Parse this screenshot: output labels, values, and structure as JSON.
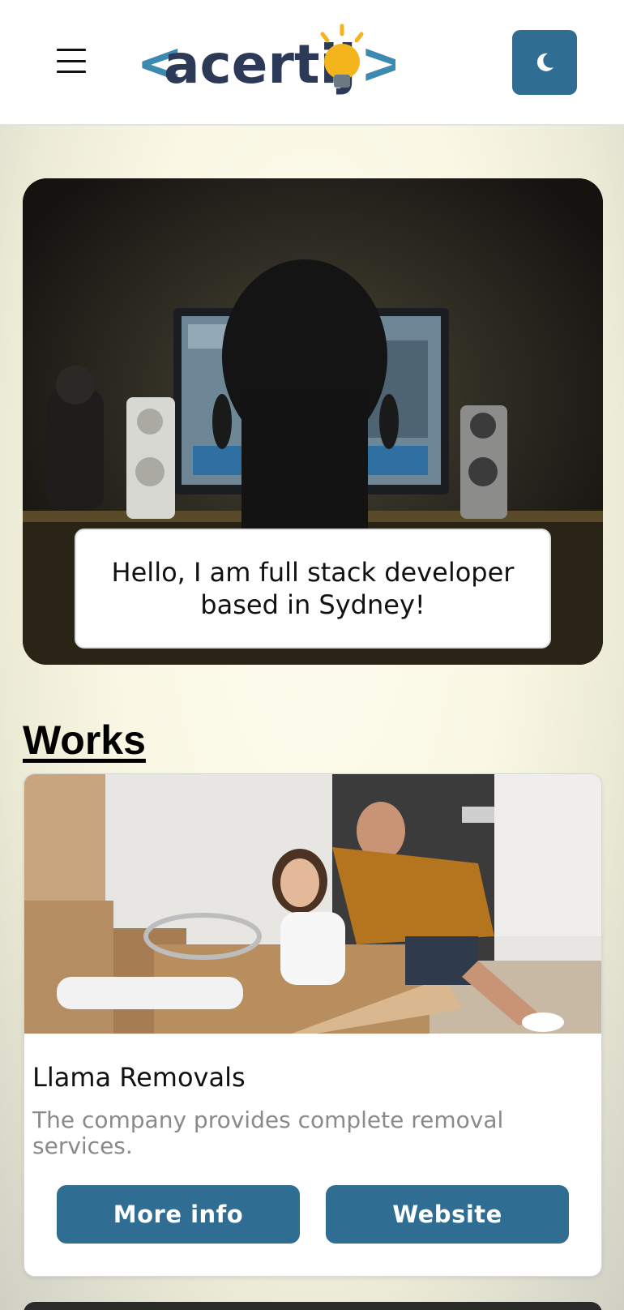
{
  "header": {
    "logo": {
      "text": "acertij",
      "bracket_left": "<",
      "bracket_right": ">"
    },
    "menu_icon": "hamburger-menu-icon",
    "theme_toggle_icon": "moon-icon"
  },
  "hero": {
    "caption": "Hello, I am full stack developer based in Sydney!"
  },
  "works": {
    "title": "Works",
    "cards": [
      {
        "title": "Llama Removals",
        "description": "The company provides complete removal services.",
        "more_info_label": "More info",
        "website_label": "Website"
      }
    ]
  },
  "colors": {
    "accent": "#2f6d93",
    "logo_text": "#2c3a57",
    "logo_bracket": "#3e89b0",
    "bulb": "#f3b51b"
  }
}
